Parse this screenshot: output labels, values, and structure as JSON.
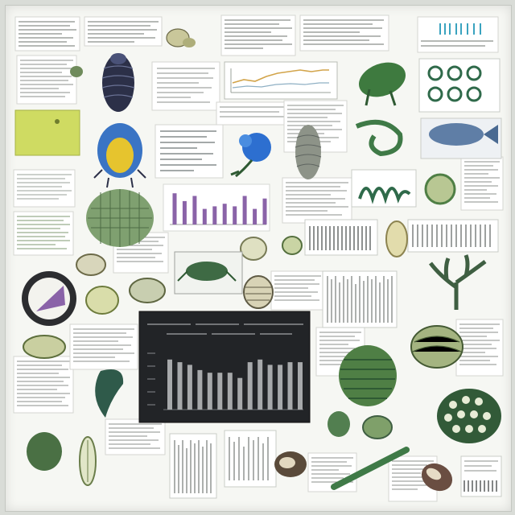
{
  "palette": {
    "paper": "#f6f7f3",
    "ink": "#2a2f2b",
    "leaf_dark": "#2f5a33",
    "leaf": "#4f7f45",
    "leaf_light": "#a9c17a",
    "olive": "#b3b38a",
    "lime": "#cfdb62",
    "sky": "#3a74c4",
    "violet": "#8a63a8",
    "navy": "#2c3048",
    "amber": "#e6c42e",
    "chart_bg": "#222427",
    "chart_bar": "#a7a9ab"
  },
  "chart_data": [
    {
      "type": "bar",
      "values": [
        12,
        9,
        11,
        6,
        7,
        8,
        7,
        11,
        6,
        10
      ],
      "ylim": [
        0,
        13
      ]
    },
    {
      "type": "bar",
      "values": [
        9.5,
        9,
        8.5,
        7.5,
        7,
        7,
        7,
        6,
        9,
        9.5,
        8.5,
        8.5,
        9,
        9
      ],
      "ylim": [
        0,
        11
      ]
    }
  ]
}
